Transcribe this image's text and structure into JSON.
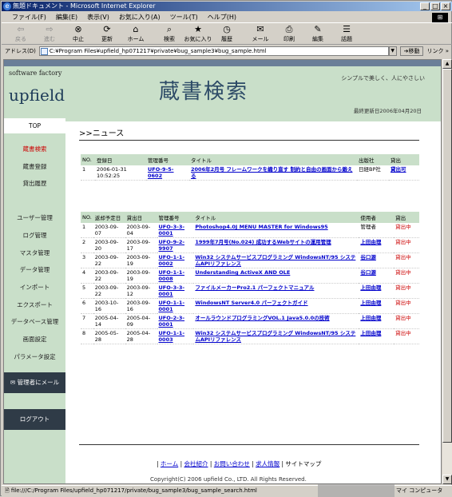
{
  "window": {
    "title": "無題ドキュメント - Microsoft Internet Explorer"
  },
  "menu": [
    "ファイル(F)",
    "編集(E)",
    "表示(V)",
    "お気に入り(A)",
    "ツール(T)",
    "ヘルプ(H)"
  ],
  "toolbar": {
    "back": "戻る",
    "forward": "進む",
    "stop": "中止",
    "refresh": "更新",
    "home": "ホーム",
    "search": "検索",
    "favorites": "お気に入り",
    "history": "履歴",
    "mail": "メール",
    "print": "印刷",
    "edit": "編集",
    "discuss": "話題"
  },
  "address": {
    "label": "アドレス(D)",
    "value": "C:¥Program Files¥upfield_hp071217¥private¥bug_sample3¥bug_sample.html",
    "go": "移動",
    "links": "リンク »"
  },
  "status": {
    "url": "file:///C:/Program Files/upfield_hp071217/private/bug_sample3/bug_sample_search.html",
    "zone": "マイ コンピュータ"
  },
  "site": {
    "brand_small": "software factory",
    "logo": "upfield",
    "title": "蔵書検索",
    "tagline": "シンプルで美しく、人にやさしい",
    "updated": "最終更新日2006年04月20日"
  },
  "nav": {
    "top": "TOP",
    "items": [
      "蔵書検索",
      "蔵書登録",
      "貸出履歴",
      "ユーザー管理",
      "ログ管理",
      "マスタ管理",
      "データ管理",
      "インポート",
      "エクスポート",
      "データベース管理",
      "画面設定",
      "パラメータ設定"
    ],
    "mail": "管理者にメール",
    "logout": "ログアウト"
  },
  "breadcrumb": ">>ニュース",
  "news": {
    "headers": [
      "NO.",
      "登録日",
      "管理番号",
      "タイトル",
      "出版社",
      "貸出"
    ],
    "rows": [
      [
        "1",
        "2006-01-31 10:52:25",
        "UFO-9-5-0602",
        "2006年2月号 フレームワークを織り直す 制約と自由の画面から鍛える",
        "日経BP社",
        "貸出可"
      ]
    ]
  },
  "loans": {
    "headers": [
      "NO.",
      "返却予定日",
      "貸出日",
      "管理番号",
      "タイトル",
      "使用者",
      "貸出"
    ],
    "rows": [
      [
        "1",
        "2003-09-07",
        "2003-09-04",
        "UFO-3-3-0001",
        "Photoshop4.0J MENU MASTER for Windows95",
        "管理者",
        "貸出中"
      ],
      [
        "2",
        "2003-09-20",
        "2003-09-17",
        "UFO-9-2-9907",
        "1999年7月号(No.024) 成功するWebサイトの運用管理",
        "上田由理",
        "貸出中"
      ],
      [
        "3",
        "2003-09-22",
        "2003-09-19",
        "UFO-1-1-0002",
        "Win32 システムサービスプログラミング WindowsNT/95 システムAPIリファレンス",
        "谷口源",
        "貸出中"
      ],
      [
        "4",
        "2003-09-22",
        "2003-09-19",
        "UFO-1-1-0008",
        "Understanding ActiveX AND OLE",
        "谷口源",
        "貸出中"
      ],
      [
        "5",
        "2003-09-22",
        "2003-09-12",
        "UFO-3-3-0001",
        "ファイルメーカーPro2.1 パーフェクトマニュアル",
        "上田由理",
        "貸出中"
      ],
      [
        "6",
        "2003-10-16",
        "2003-09-16",
        "UFO-1-1-0001",
        "WindowsNT Server4.0 パーフェクトガイド",
        "上田由理",
        "貸出中"
      ],
      [
        "7",
        "2005-04-14",
        "2005-04-09",
        "UFO-2-3-0001",
        "オールラウンドプログラミングVOL.1 Java5.0.0の技術",
        "上田由理",
        "貸出中"
      ],
      [
        "8",
        "2005-05-28",
        "2005-04-28",
        "UFO-1-1-0003",
        "Win32 システムサービスプログラミング WindowsNT/95 システムAPIリファレンス",
        "上田由理",
        "貸出中"
      ]
    ]
  },
  "footer": {
    "links": [
      "ホーム",
      "会社紹介",
      "お問い合わせ",
      "求人情報",
      "サイトマップ"
    ],
    "copyright": "Copyright(C) 2006 upfield Co., LTD. All Rights Reserved."
  }
}
